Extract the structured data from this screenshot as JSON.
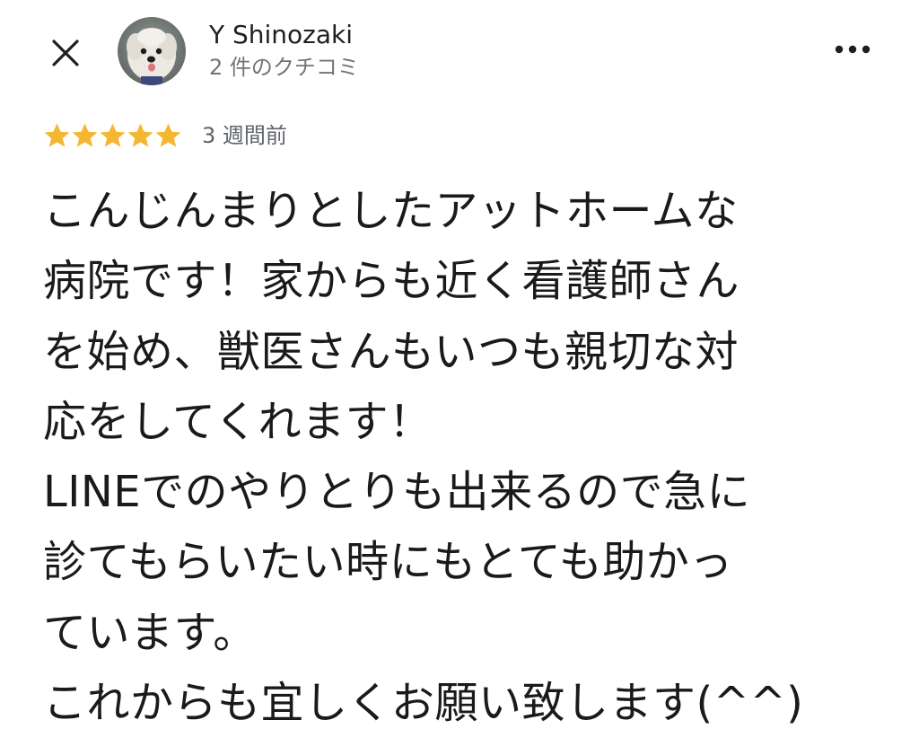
{
  "header": {
    "user_name": "Y Shinozaki",
    "review_count": "2 件のクチコミ",
    "close_icon": "close-icon",
    "more_icon": "more-horizontal-icon"
  },
  "review": {
    "rating": 5,
    "rating_max": 5,
    "date": "3 週間前",
    "lines": [
      "こんじんまりとしたアットホームな",
      "病院です！家からも近く看護師さん",
      "を始め、獣医さんもいつも親切な対",
      "応をしてくれます！",
      "LINEでのやりとりも出来るので急に",
      "診てもらいたい時にもとても助かっ",
      "ています。",
      "これからも宜しくお願い致します(^^)"
    ]
  },
  "colors": {
    "star": "#f5b731",
    "text": "#1a1a1a",
    "secondary_text": "#70757a"
  }
}
